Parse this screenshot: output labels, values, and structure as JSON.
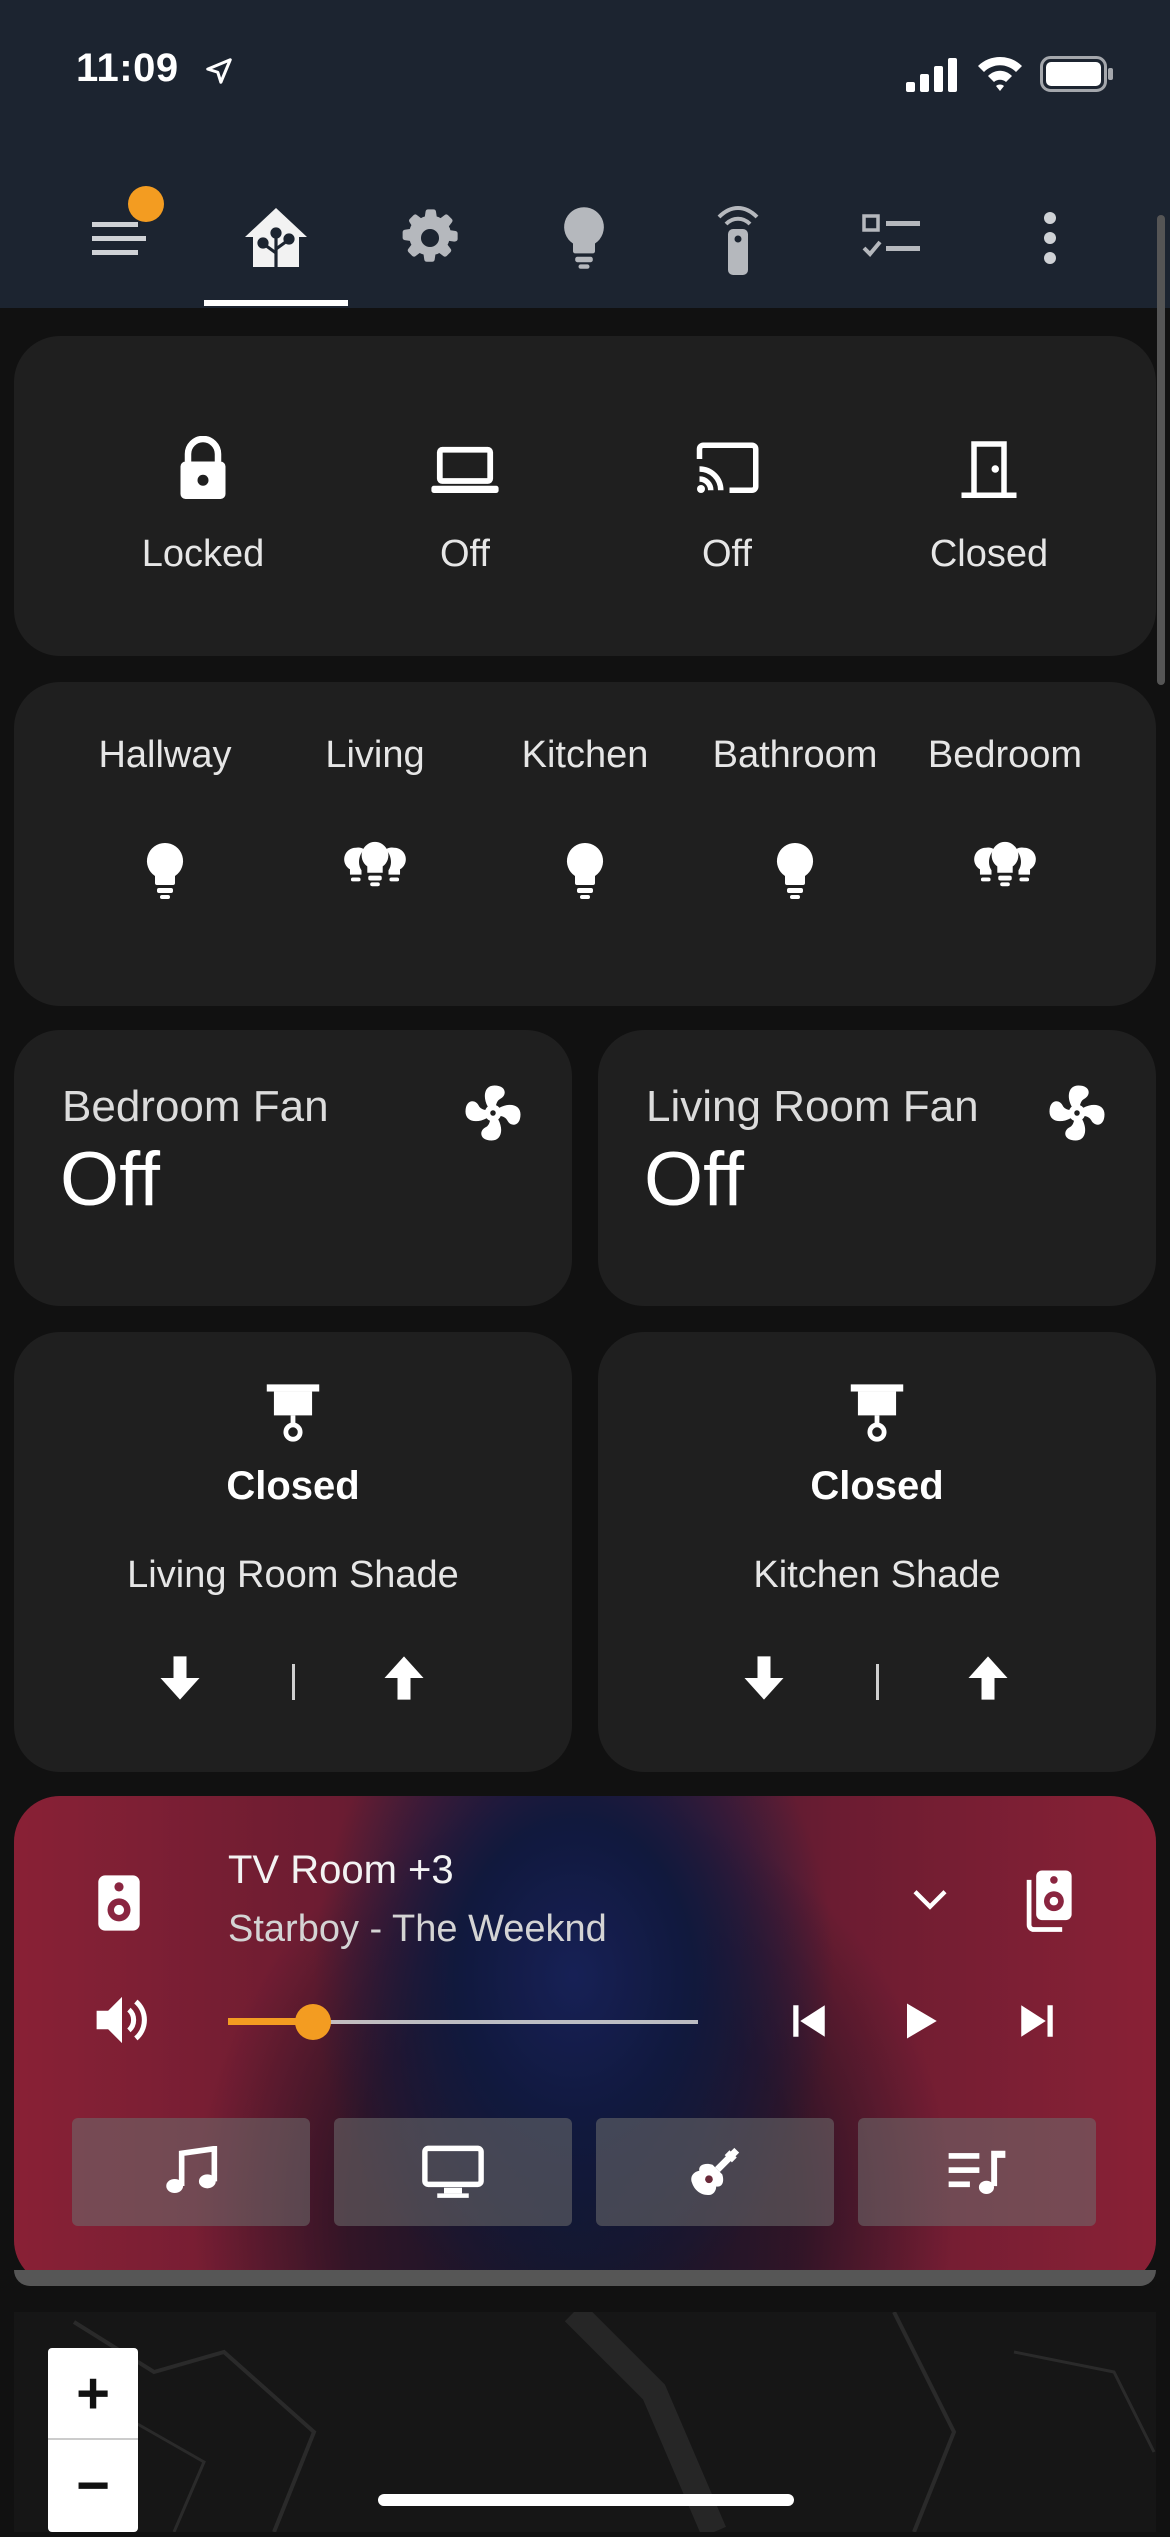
{
  "status_bar": {
    "time": "11:09",
    "icons": [
      "location-arrow-icon",
      "cellular-signal-icon",
      "wifi-icon",
      "battery-icon"
    ]
  },
  "toolbar": {
    "tabs": [
      {
        "name": "menu",
        "icon": "menu-icon"
      },
      {
        "name": "home",
        "icon": "home-assistant-icon",
        "active": true
      },
      {
        "name": "settings",
        "icon": "gear-icon"
      },
      {
        "name": "lights",
        "icon": "lightbulb-icon"
      },
      {
        "name": "remote",
        "icon": "remote-icon"
      },
      {
        "name": "checklist",
        "icon": "checklist-icon"
      },
      {
        "name": "more",
        "icon": "more-vertical-icon"
      }
    ],
    "accent": "#f39c21"
  },
  "glance": {
    "items": [
      {
        "icon": "lock-icon",
        "label": "Locked"
      },
      {
        "icon": "laptop-icon",
        "label": "Off"
      },
      {
        "icon": "cast-icon",
        "label": "Off"
      },
      {
        "icon": "door-icon",
        "label": "Closed"
      }
    ]
  },
  "lights": {
    "items": [
      {
        "label": "Hallway",
        "icon": "lightbulb-icon"
      },
      {
        "label": "Living",
        "icon": "lightbulb-group-icon"
      },
      {
        "label": "Kitchen",
        "icon": "lightbulb-icon"
      },
      {
        "label": "Bathroom",
        "icon": "lightbulb-icon"
      },
      {
        "label": "Bedroom",
        "icon": "lightbulb-group-icon"
      }
    ]
  },
  "fans": [
    {
      "name": "Bedroom Fan",
      "state": "Off",
      "icon": "fan-icon"
    },
    {
      "name": "Living Room Fan",
      "state": "Off",
      "icon": "fan-icon"
    }
  ],
  "shades": [
    {
      "state": "Closed",
      "name": "Living Room Shade",
      "icon": "shade-icon"
    },
    {
      "state": "Closed",
      "name": "Kitchen Shade",
      "icon": "shade-icon"
    }
  ],
  "media": {
    "title": "TV Room +3",
    "subtitle": "Starboy - The Weeknd",
    "progress": 0.18,
    "sources": [
      "music-note-icon",
      "monitor-icon",
      "guitar-icon",
      "playlist-music-icon"
    ]
  },
  "map": {
    "zoom_in": "+",
    "zoom_out": "−"
  }
}
